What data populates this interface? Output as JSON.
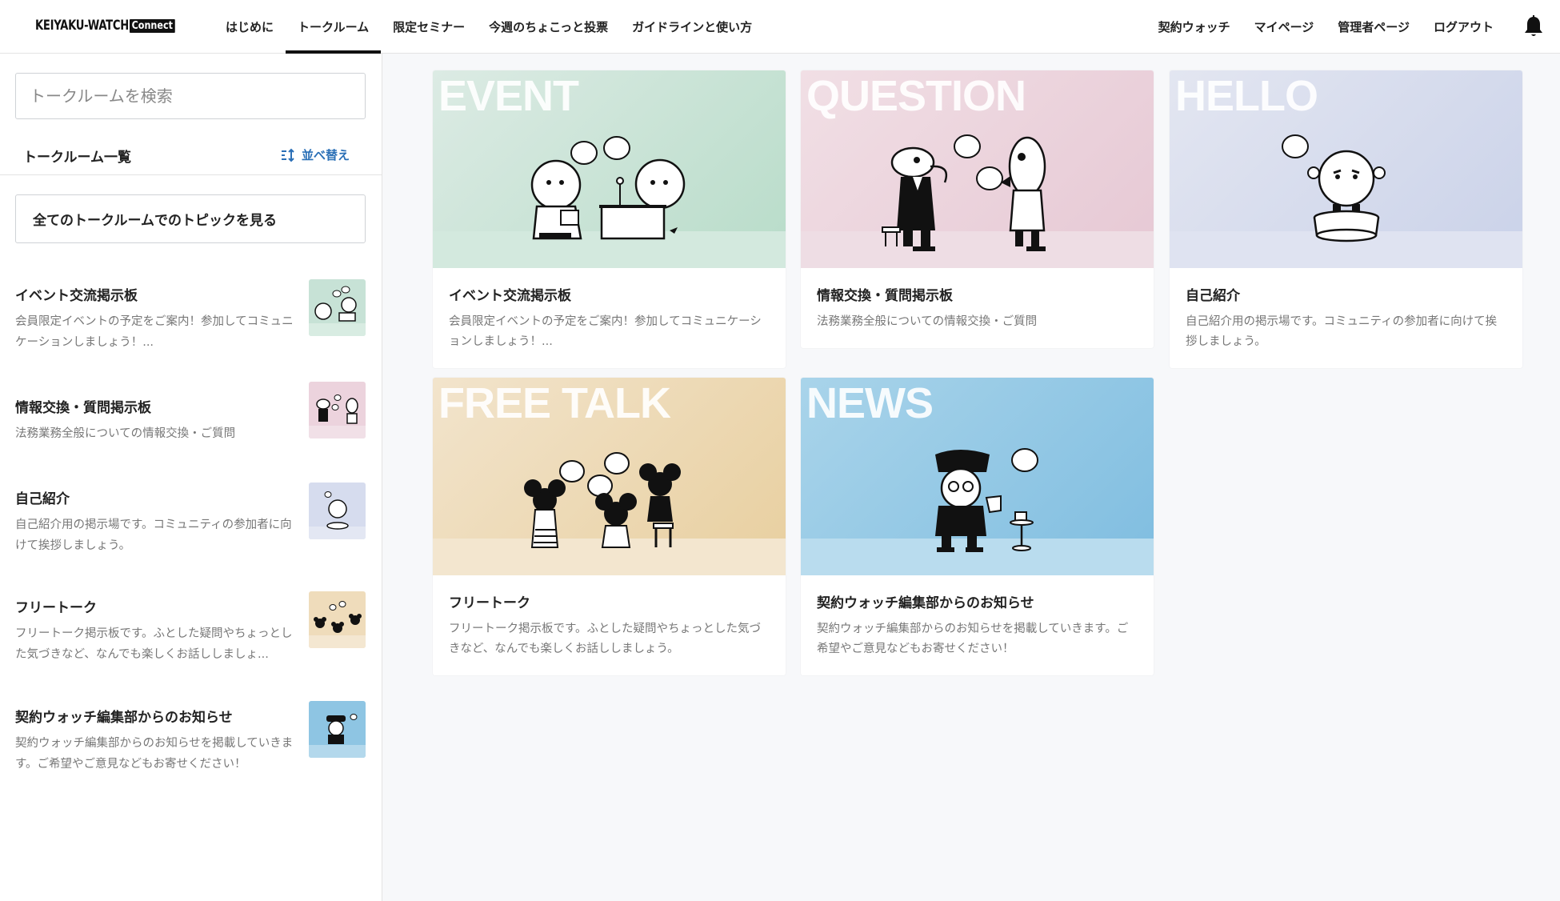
{
  "header": {
    "logo_text": "KEIYAKU-WATCH",
    "logo_badge": "Connect",
    "nav_left": [
      "はじめに",
      "トークルーム",
      "限定セミナー",
      "今週のちょこっと投票",
      "ガイドラインと使い方"
    ],
    "nav_right": [
      "契約ウォッチ",
      "マイページ",
      "管理者ページ",
      "ログアウト"
    ],
    "active_index": 1,
    "bell_icon": "bell-icon"
  },
  "sidebar": {
    "search_placeholder": "トークルームを検索",
    "list_title": "トークルーム一覧",
    "sort_label": "並べ替え",
    "sort_icon": "sort-icon",
    "all_topics_label": "全てのトークルームでのトピックを見る",
    "rooms": [
      {
        "name": "イベント交流掲示板",
        "desc": "会員限定イベントの予定をご案内！参加してコミュニケーションしましょう！...",
        "color": "#c7e2d6"
      },
      {
        "name": "情報交換・質問掲示板",
        "desc": "法務業務全般についての情報交換・ご質問",
        "color": "#ecd3dd"
      },
      {
        "name": "自己紹介",
        "desc": "自己紹介用の掲示場です。コミュニティの参加者に向けて挨拶しましょう。",
        "color": "#d6dcee"
      },
      {
        "name": "フリートーク",
        "desc": "フリートーク掲示板です。ふとした疑問やちょっとした気づきなど、なんでも楽しくお話ししましょ...",
        "color": "#efdcbb"
      },
      {
        "name": "契約ウォッチ編集部からのお知らせ",
        "desc": "契約ウォッチ編集部からのお知らせを掲載していきます。ご希望やご意見などもお寄せください！",
        "color": "#8ec5e3"
      }
    ]
  },
  "cards": [
    {
      "label": "EVENT",
      "title": "イベント交流掲示板",
      "desc": "会員限定イベントの予定をご案内！参加してコミュニケーションしましょう！...",
      "bg_top": "#dcebe4",
      "bg_bottom": "#b8dcc9",
      "floor": "#d3e9de"
    },
    {
      "label": "QUESTION",
      "title": "情報交換・質問掲示板",
      "desc": "法務業務全般についての情報交換・ご質問",
      "bg_top": "#f1dfe5",
      "bg_bottom": "#e6c8d4",
      "floor": "#eedde4"
    },
    {
      "label": "HELLO",
      "title": "自己紹介",
      "desc": "自己紹介用の掲示場です。コミュニティの参加者に向けて挨拶しましょう。",
      "bg_top": "#e3e6f1",
      "bg_bottom": "#cad2e9",
      "floor": "#dfe3f1"
    },
    {
      "label": "FREE TALK",
      "title": "フリートーク",
      "desc": "フリートーク掲示板です。ふとした疑問やちょっとした気づきなど、なんでも楽しくお話ししましょう。",
      "bg_top": "#f2e4cc",
      "bg_bottom": "#e8cf9f",
      "floor": "#f3e6cf"
    },
    {
      "label": "NEWS",
      "title": "契約ウォッチ編集部からのお知らせ",
      "desc": "契約ウォッチ編集部からのお知らせを掲載していきます。ご希望やご意見などもお寄せください！",
      "bg_top": "#a9d4ea",
      "bg_bottom": "#7fbde0",
      "floor": "#b9dcee"
    }
  ]
}
